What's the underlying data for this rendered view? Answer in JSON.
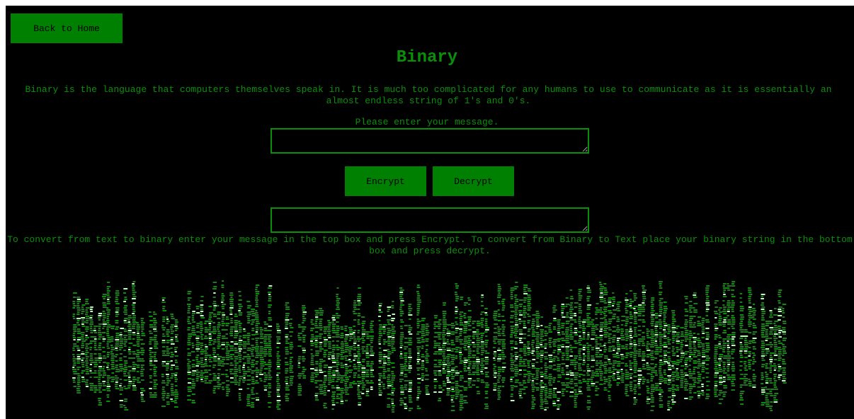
{
  "nav": {
    "back_label": "Back to Home"
  },
  "page": {
    "title": "Binary",
    "intro": "Binary is the language that computers themselves speak in. It is much too complicated for any humans to use to communicate as it is essentially an almost endless string of 1's and 0's.",
    "prompt": "Please enter your message.",
    "help": "To convert from text to binary enter your message in the top box and press Encrypt. To convert from Binary to Text place your binary string in the bottom box and press decrypt."
  },
  "inputs": {
    "message_value": "",
    "result_value": ""
  },
  "actions": {
    "encrypt_label": "Encrypt",
    "decrypt_label": "Decrypt"
  },
  "theme": {
    "background": "#000000",
    "text_green": "#0a8f0a",
    "button_green": "#008000",
    "rain_bright": "#b8ffb8",
    "rain_dim": "#1f7a1f"
  }
}
